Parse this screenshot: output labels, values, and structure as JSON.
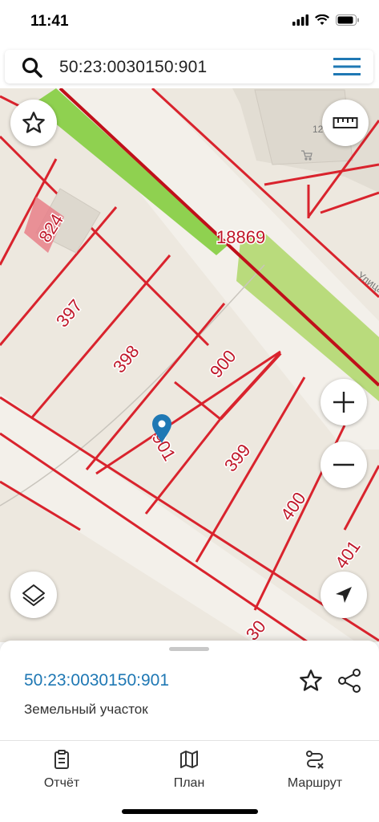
{
  "status_bar": {
    "time": "11:41"
  },
  "search": {
    "query": "50:23:0030150:901"
  },
  "map": {
    "parcels": [
      {
        "id": "824",
        "label": "824"
      },
      {
        "id": "397",
        "label": "397"
      },
      {
        "id": "398",
        "label": "398"
      },
      {
        "id": "900",
        "label": "900"
      },
      {
        "id": "901",
        "label": "901"
      },
      {
        "id": "399",
        "label": "399"
      },
      {
        "id": "400",
        "label": "400"
      },
      {
        "id": "401",
        "label": "401"
      },
      {
        "id": "18869",
        "label": "18869"
      },
      {
        "id": "12",
        "label": "12"
      },
      {
        "id": "30x",
        "label": "30"
      }
    ],
    "street_label": "Улица",
    "colors": {
      "boundary": "#d9232d",
      "road_boundary": "#c0101a",
      "green": "#b9db7c",
      "road": "#f3f0ea"
    },
    "buttons": {
      "favorite": "star-icon",
      "ruler": "ruler-icon",
      "zoom_in": "plus-icon",
      "zoom_out": "minus-icon",
      "layers": "layers-icon",
      "locate": "navigation-arrow-icon"
    }
  },
  "sheet": {
    "title": "50:23:0030150:901",
    "subtitle": "Земельный участок"
  },
  "tabs": [
    {
      "label": "Отчёт",
      "icon": "report-icon"
    },
    {
      "label": "План",
      "icon": "map-icon"
    },
    {
      "label": "Маршрут",
      "icon": "route-icon"
    }
  ]
}
